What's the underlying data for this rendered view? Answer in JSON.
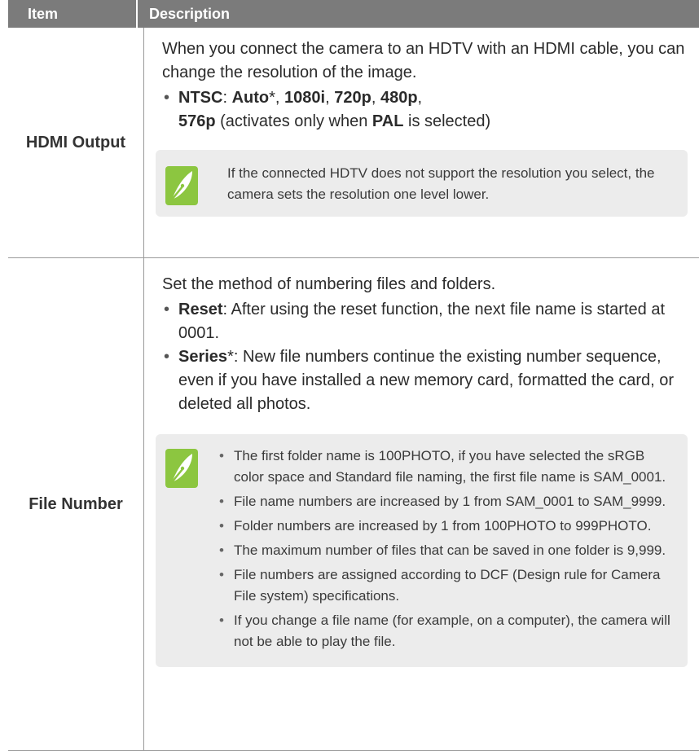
{
  "header": {
    "item": "Item",
    "description": "Description"
  },
  "rows": [
    {
      "item": "HDMI Output",
      "intro": "When you connect the camera to an HDTV with an HDMI cable, you can change the resolution of the image.",
      "bullet": {
        "label": "NTSC",
        "sep1": ": ",
        "opt1": "Auto",
        "star": "*",
        "c1": ", ",
        "opt2": "1080i",
        "c2": ", ",
        "opt3": "720p",
        "c3": ", ",
        "opt4": "480p",
        "c4": ",",
        "opt5": "576p",
        "mid": " (activates only when ",
        "pal": "PAL",
        "end": " is selected)"
      },
      "note": "If the connected HDTV does not support the resolution you select, the camera sets the resolution one level lower."
    },
    {
      "item": "File Number",
      "intro": "Set the method of numbering files and folders.",
      "bullets": [
        {
          "label": "Reset",
          "text": ": After using the reset function, the next file name is started at 0001."
        },
        {
          "label": "Series",
          "star": "*",
          "text": ": New file numbers continue the existing number sequence, even if you have installed a new memory card, formatted the card, or deleted all photos."
        }
      ],
      "notes": [
        "The first folder name is 100PHOTO, if you have selected the sRGB color space and Standard file naming, the first file name is SAM_0001.",
        "File name numbers are increased by 1 from SAM_0001 to SAM_9999.",
        "Folder numbers are increased by 1 from 100PHOTO to 999PHOTO.",
        "The maximum number of files that can be saved in one folder is 9,999.",
        "File numbers are assigned according to DCF (Design rule for Camera File system) specifications.",
        "If you change a file name (for example, on a computer), the camera will not be able to play the file."
      ]
    }
  ],
  "icons": {
    "note": "note-pen-icon"
  },
  "colors": {
    "header_bg": "#7b7b7b",
    "note_bg": "#ececec",
    "icon_bg": "#8cc640"
  }
}
